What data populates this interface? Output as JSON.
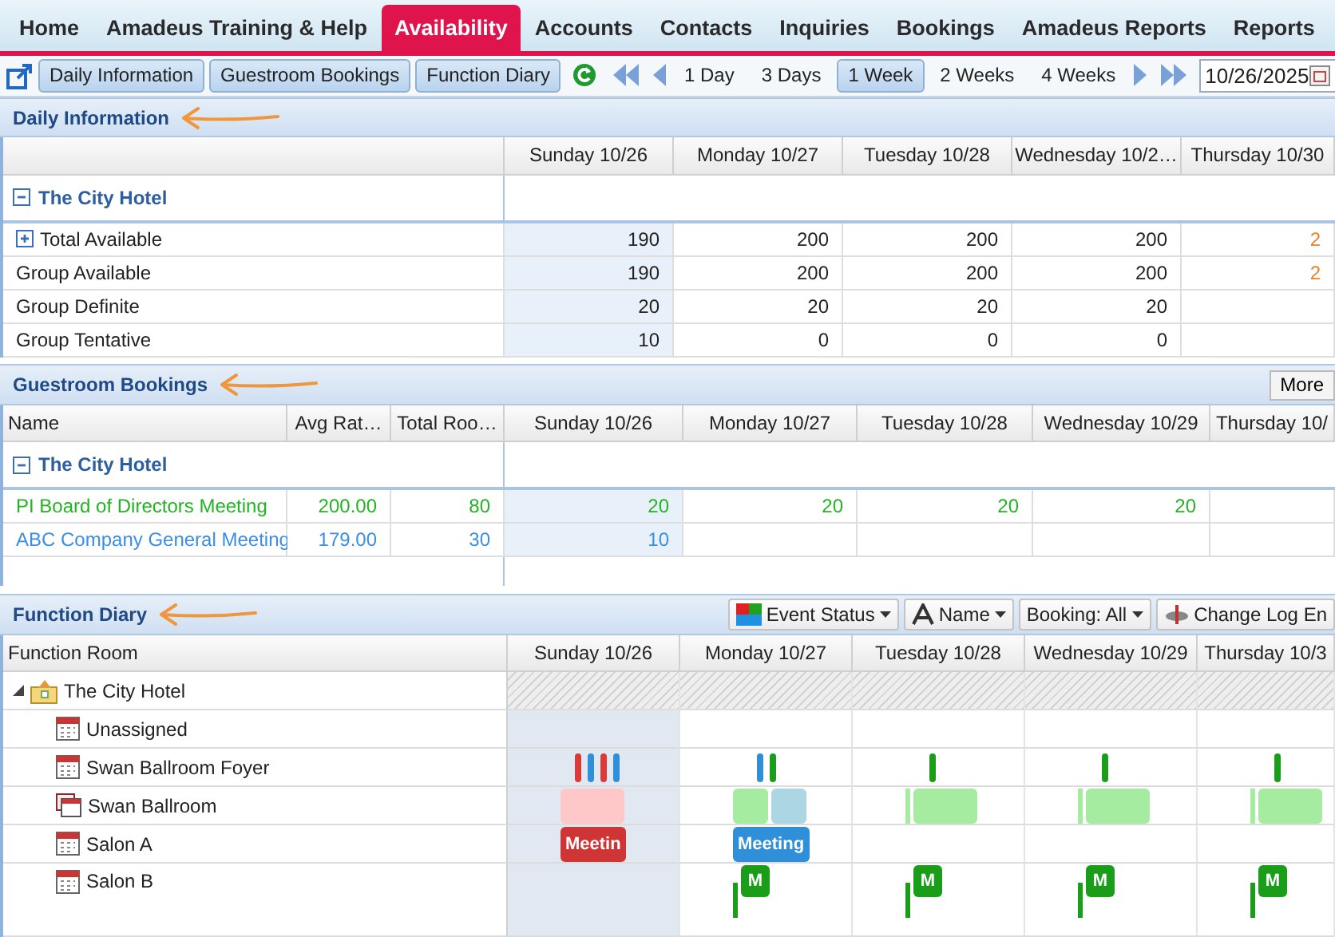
{
  "nav": [
    {
      "label": "Home",
      "selected": false
    },
    {
      "label": "Amadeus Training & Help",
      "selected": false
    },
    {
      "label": "Availability",
      "selected": true
    },
    {
      "label": "Accounts",
      "selected": false
    },
    {
      "label": "Contacts",
      "selected": false
    },
    {
      "label": "Inquiries",
      "selected": false
    },
    {
      "label": "Bookings",
      "selected": false
    },
    {
      "label": "Amadeus Reports",
      "selected": false
    },
    {
      "label": "Reports",
      "selected": false
    }
  ],
  "toolbar": {
    "views": [
      {
        "label": "Daily Information",
        "selected": true
      },
      {
        "label": "Guestroom Bookings",
        "selected": true
      },
      {
        "label": "Function Diary",
        "selected": true
      }
    ],
    "ranges": [
      {
        "label": "1 Day",
        "selected": false
      },
      {
        "label": "3 Days",
        "selected": false
      },
      {
        "label": "1 Week",
        "selected": true
      },
      {
        "label": "2 Weeks",
        "selected": false
      },
      {
        "label": "4 Weeks",
        "selected": false
      }
    ],
    "date": "10/26/2025"
  },
  "daily": {
    "title": "Daily Information",
    "days": [
      {
        "label": "Sunday 10/26",
        "today": true
      },
      {
        "label": "Monday 10/27",
        "today": false
      },
      {
        "label": "Tuesday 10/28",
        "today": false
      },
      {
        "label": "Wednesday 10/2…",
        "today": false
      },
      {
        "label": "Thursday 10/30",
        "today": false
      }
    ],
    "group": {
      "name": "The City Hotel",
      "expanded": true
    },
    "rows": [
      {
        "label": "Total Available",
        "expandable": true,
        "values": [
          "190",
          "200",
          "200",
          "200",
          "2"
        ],
        "alerts": [
          false,
          false,
          false,
          false,
          true
        ]
      },
      {
        "label": "Group Available",
        "expandable": false,
        "values": [
          "190",
          "200",
          "200",
          "200",
          "2"
        ],
        "alerts": [
          false,
          false,
          false,
          false,
          true
        ]
      },
      {
        "label": "Group Definite",
        "expandable": false,
        "values": [
          "20",
          "20",
          "20",
          "20"
        ],
        "alerts": [
          false,
          false,
          false,
          false
        ]
      },
      {
        "label": "Group Tentative",
        "expandable": false,
        "values": [
          "10",
          "0",
          "0",
          "0"
        ],
        "alerts": [
          false,
          false,
          false,
          false
        ]
      }
    ]
  },
  "guestroom": {
    "title": "Guestroom Bookings",
    "more": "More",
    "columns": [
      "Name",
      "Avg Rat…",
      "Total Roo…"
    ],
    "days": [
      {
        "label": "Sunday 10/26",
        "today": true
      },
      {
        "label": "Monday 10/27",
        "today": false
      },
      {
        "label": "Tuesday 10/28",
        "today": false
      },
      {
        "label": "Wednesday 10/29",
        "today": false
      },
      {
        "label": "Thursday 10/",
        "today": false
      }
    ],
    "group": {
      "name": "The City Hotel",
      "expanded": true
    },
    "rows": [
      {
        "name": "PI Board of Directors Meeting",
        "avg_rate": "200.00",
        "total_rooms": "80",
        "color": "#22b322",
        "values": [
          "20",
          "20",
          "20",
          "20"
        ]
      },
      {
        "name": "ABC Company General Meeting",
        "avg_rate": "179.00",
        "total_rooms": "30",
        "color": "#3a8ee6",
        "values": [
          "10"
        ]
      }
    ]
  },
  "diary": {
    "title": "Function Diary",
    "tools": [
      {
        "label": "Event Status",
        "kind": "status"
      },
      {
        "label": "Name",
        "kind": "font"
      },
      {
        "label": "Booking: All",
        "kind": "plain"
      },
      {
        "label": "Change Log En",
        "kind": "log"
      }
    ],
    "column": "Function Room",
    "days": [
      {
        "label": "Sunday 10/26"
      },
      {
        "label": "Monday 10/27"
      },
      {
        "label": "Tuesday 10/28"
      },
      {
        "label": "Wednesday 10/29"
      },
      {
        "label": "Thursday 10/3"
      }
    ],
    "tree": {
      "name": "The City Hotel",
      "expanded": true,
      "children": [
        {
          "name": "Unassigned",
          "kind": "room",
          "days": [
            {
              "today": true
            },
            {
              "today": false
            },
            {
              "today": false
            },
            {
              "today": false
            },
            {
              "today": false
            }
          ]
        },
        {
          "name": "Swan Ballroom Foyer",
          "kind": "room",
          "days": [
            {
              "today": true,
              "events": [
                {
                  "kind": "bar",
                  "color": "#d93a3a"
                },
                {
                  "kind": "bar",
                  "color": "#2f8fd8"
                },
                {
                  "kind": "bar",
                  "color": "#d93a3a"
                },
                {
                  "kind": "bar",
                  "color": "#2f8fd8"
                }
              ]
            },
            {
              "today": false,
              "events": [
                {
                  "kind": "bar",
                  "color": "#2f8fd8"
                },
                {
                  "kind": "bar",
                  "color": "#1a9e1a"
                }
              ]
            },
            {
              "today": false,
              "events": [
                {
                  "kind": "bar",
                  "color": "#1a9e1a"
                }
              ]
            },
            {
              "today": false,
              "events": [
                {
                  "kind": "bar",
                  "color": "#1a9e1a"
                }
              ]
            },
            {
              "today": false,
              "events": [
                {
                  "kind": "bar",
                  "color": "#1a9e1a"
                }
              ]
            }
          ]
        },
        {
          "name": "Swan Ballroom",
          "kind": "combo",
          "days": [
            {
              "today": true,
              "events": [
                {
                  "kind": "block",
                  "color": "#ffc8c8"
                }
              ]
            },
            {
              "today": false,
              "events": [
                {
                  "kind": "block",
                  "color": "#a6eca0"
                },
                {
                  "kind": "block",
                  "color": "#acd6e4"
                }
              ]
            },
            {
              "today": false,
              "events": [
                {
                  "kind": "sliver",
                  "color": "#a6eca0"
                },
                {
                  "kind": "block",
                  "color": "#a6eca0"
                }
              ]
            },
            {
              "today": false,
              "events": [
                {
                  "kind": "sliver",
                  "color": "#a6eca0"
                },
                {
                  "kind": "block",
                  "color": "#a6eca0"
                }
              ]
            },
            {
              "today": false,
              "events": [
                {
                  "kind": "sliver",
                  "color": "#a6eca0"
                },
                {
                  "kind": "block",
                  "color": "#a6eca0"
                }
              ]
            }
          ]
        },
        {
          "name": "Salon A",
          "kind": "room",
          "days": [
            {
              "today": true,
              "events": [
                {
                  "kind": "label",
                  "color": "#cf3535",
                  "label": "Meetin"
                }
              ]
            },
            {
              "today": false,
              "events": [
                {
                  "kind": "label",
                  "color": "#2f8fd8",
                  "label": "Meeting"
                }
              ]
            },
            {
              "today": false
            },
            {
              "today": false
            },
            {
              "today": false
            }
          ]
        },
        {
          "name": "Salon B",
          "kind": "room",
          "days": [
            {
              "today": true
            },
            {
              "today": false,
              "events": [
                {
                  "kind": "sliver",
                  "color": "#1a9e1a"
                },
                {
                  "kind": "badge",
                  "color": "#1a9e1a",
                  "label": "M"
                }
              ]
            },
            {
              "today": false,
              "events": [
                {
                  "kind": "sliver",
                  "color": "#1a9e1a"
                },
                {
                  "kind": "badge",
                  "color": "#1a9e1a",
                  "label": "M"
                }
              ]
            },
            {
              "today": false,
              "events": [
                {
                  "kind": "sliver",
                  "color": "#1a9e1a"
                },
                {
                  "kind": "badge",
                  "color": "#1a9e1a",
                  "label": "M"
                }
              ]
            },
            {
              "today": false,
              "events": [
                {
                  "kind": "sliver",
                  "color": "#1a9e1a"
                },
                {
                  "kind": "badge",
                  "color": "#1a9e1a",
                  "label": "M"
                }
              ]
            }
          ]
        }
      ]
    }
  }
}
